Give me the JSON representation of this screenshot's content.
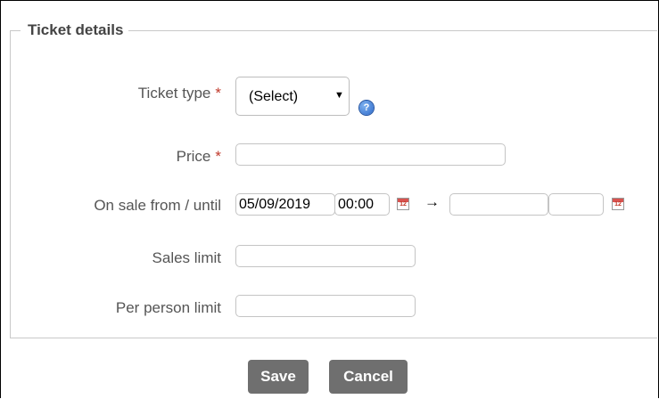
{
  "section": {
    "legend": "Ticket details"
  },
  "fields": {
    "ticket_type": {
      "label": "Ticket type",
      "required_mark": "*",
      "selected": "(Select)",
      "caret": "▼",
      "help": "?"
    },
    "price": {
      "label": "Price",
      "required_mark": "*",
      "value": ""
    },
    "on_sale": {
      "label": "On sale from / until",
      "from_date": "05/09/2019",
      "from_time": "00:00",
      "arrow": "→",
      "until_date": "",
      "until_time": "",
      "calendar_glyph": "12"
    },
    "sales_limit": {
      "label": "Sales limit",
      "value": ""
    },
    "per_person_limit": {
      "label": "Per person limit",
      "value": ""
    }
  },
  "buttons": {
    "save": "Save",
    "cancel": "Cancel"
  }
}
